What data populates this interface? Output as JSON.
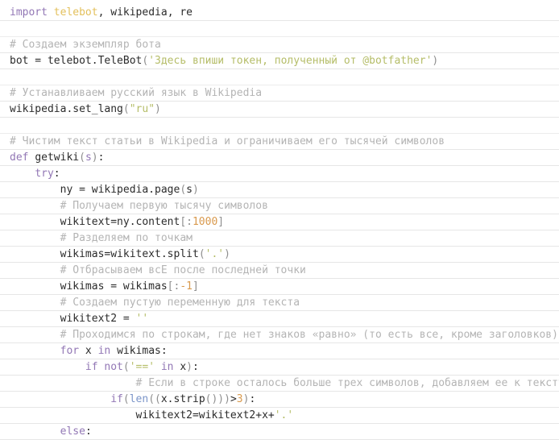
{
  "document": {
    "kind": "python-source-listing",
    "language": "Python",
    "theme": {
      "background": "#ffffff",
      "rule": "#e6e6e6",
      "plain": "#2b2b2b",
      "keyword": "#9277b5",
      "module": "#e3c05c",
      "string": "#b5bd68",
      "number": "#d99a4e",
      "comment": "#b4b4b4",
      "punctuation": "#8f8f8f",
      "builtin": "#7b95c9"
    }
  },
  "lines": [
    {
      "id": 1,
      "blank": false,
      "text": "import telebot, wikipedia, re",
      "tokens": [
        {
          "t": "import",
          "c": "kw"
        },
        {
          "t": " ",
          "c": "plain"
        },
        {
          "t": "telebot",
          "c": "mod"
        },
        {
          "t": ", ",
          "c": "plain"
        },
        {
          "t": "wikipedia",
          "c": "plain"
        },
        {
          "t": ", ",
          "c": "plain"
        },
        {
          "t": "re",
          "c": "plain"
        }
      ]
    },
    {
      "id": 2,
      "blank": true,
      "text": "",
      "tokens": []
    },
    {
      "id": 3,
      "blank": false,
      "text": "# Создаем экземпляр бота",
      "tokens": [
        {
          "t": "# Создаем экземпляр бота",
          "c": "com"
        }
      ]
    },
    {
      "id": 4,
      "blank": false,
      "text": "bot = telebot.TeleBot('Здесь впиши токен, полученный от @botfather')",
      "tokens": [
        {
          "t": "bot = telebot.TeleBot",
          "c": "plain"
        },
        {
          "t": "(",
          "c": "punct"
        },
        {
          "t": "'Здесь впиши токен, полученный от @botfather'",
          "c": "str"
        },
        {
          "t": ")",
          "c": "punct"
        }
      ]
    },
    {
      "id": 5,
      "blank": true,
      "text": "",
      "tokens": []
    },
    {
      "id": 6,
      "blank": false,
      "text": "# Устанавливаем русский язык в Wikipedia",
      "tokens": [
        {
          "t": "# Устанавливаем русский язык в Wikipedia",
          "c": "com"
        }
      ]
    },
    {
      "id": 7,
      "blank": false,
      "text": "wikipedia.set_lang(\"ru\")",
      "tokens": [
        {
          "t": "wikipedia.set_lang",
          "c": "plain"
        },
        {
          "t": "(",
          "c": "punct"
        },
        {
          "t": "\"ru\"",
          "c": "str"
        },
        {
          "t": ")",
          "c": "punct"
        }
      ]
    },
    {
      "id": 8,
      "blank": true,
      "text": "",
      "tokens": []
    },
    {
      "id": 9,
      "blank": false,
      "text": "# Чистим текст статьи в Wikipedia и ограничиваем его тысячей символов",
      "tokens": [
        {
          "t": "# Чистим текст статьи в Wikipedia и ограничиваем его тысячей символов",
          "c": "com"
        }
      ]
    },
    {
      "id": 10,
      "blank": false,
      "text": "def getwiki(s):",
      "tokens": [
        {
          "t": "def",
          "c": "kw"
        },
        {
          "t": " ",
          "c": "plain"
        },
        {
          "t": "getwiki",
          "c": "fn"
        },
        {
          "t": "(",
          "c": "punct"
        },
        {
          "t": "s",
          "c": "param"
        },
        {
          "t": ")",
          "c": "punct"
        },
        {
          "t": ":",
          "c": "plain"
        }
      ]
    },
    {
      "id": 11,
      "blank": false,
      "text": "    try:",
      "tokens": [
        {
          "t": "    ",
          "c": "plain"
        },
        {
          "t": "try",
          "c": "kw"
        },
        {
          "t": ":",
          "c": "plain"
        }
      ]
    },
    {
      "id": 12,
      "blank": false,
      "text": "        ny = wikipedia.page(s)",
      "tokens": [
        {
          "t": "        ny = wikipedia.page",
          "c": "plain"
        },
        {
          "t": "(",
          "c": "punct"
        },
        {
          "t": "s",
          "c": "plain"
        },
        {
          "t": ")",
          "c": "punct"
        }
      ]
    },
    {
      "id": 13,
      "blank": false,
      "text": "        # Получаем первую тысячу символов",
      "tokens": [
        {
          "t": "        ",
          "c": "plain"
        },
        {
          "t": "# Получаем первую тысячу символов",
          "c": "com"
        }
      ]
    },
    {
      "id": 14,
      "blank": false,
      "text": "        wikitext=ny.content[:1000]",
      "tokens": [
        {
          "t": "        wikitext=ny.content",
          "c": "plain"
        },
        {
          "t": "[:",
          "c": "punct"
        },
        {
          "t": "1000",
          "c": "num"
        },
        {
          "t": "]",
          "c": "punct"
        }
      ]
    },
    {
      "id": 15,
      "blank": false,
      "text": "        # Разделяем по точкам",
      "tokens": [
        {
          "t": "        ",
          "c": "plain"
        },
        {
          "t": "# Разделяем по точкам",
          "c": "com"
        }
      ]
    },
    {
      "id": 16,
      "blank": false,
      "text": "        wikimas=wikitext.split('.')",
      "tokens": [
        {
          "t": "        wikimas=wikitext.split",
          "c": "plain"
        },
        {
          "t": "(",
          "c": "punct"
        },
        {
          "t": "'.'",
          "c": "str"
        },
        {
          "t": ")",
          "c": "punct"
        }
      ]
    },
    {
      "id": 17,
      "blank": false,
      "text": "        # Отбрасываем всЕ после последней точки",
      "tokens": [
        {
          "t": "        ",
          "c": "plain"
        },
        {
          "t": "# Отбрасываем всЕ после последней точки",
          "c": "com"
        }
      ]
    },
    {
      "id": 18,
      "blank": false,
      "text": "        wikimas = wikimas[:-1]",
      "tokens": [
        {
          "t": "        wikimas = wikimas",
          "c": "plain"
        },
        {
          "t": "[:",
          "c": "punct"
        },
        {
          "t": "-1",
          "c": "num"
        },
        {
          "t": "]",
          "c": "punct"
        }
      ]
    },
    {
      "id": 19,
      "blank": false,
      "text": "        # Создаем пустую переменную для текста",
      "tokens": [
        {
          "t": "        ",
          "c": "plain"
        },
        {
          "t": "# Создаем пустую переменную для текста",
          "c": "com"
        }
      ]
    },
    {
      "id": 20,
      "blank": false,
      "text": "        wikitext2 = ''",
      "tokens": [
        {
          "t": "        wikitext2 = ",
          "c": "plain"
        },
        {
          "t": "''",
          "c": "str"
        }
      ]
    },
    {
      "id": 21,
      "blank": false,
      "text": "        # Проходимся по строкам, где нет знаков «равно» (то есть все, кроме заголовков)",
      "tokens": [
        {
          "t": "        ",
          "c": "plain"
        },
        {
          "t": "# Проходимся по строкам, где нет знаков «равно» (то есть все, кроме заголовков)",
          "c": "com"
        }
      ]
    },
    {
      "id": 22,
      "blank": false,
      "text": "        for x in wikimas:",
      "tokens": [
        {
          "t": "        ",
          "c": "plain"
        },
        {
          "t": "for",
          "c": "kw"
        },
        {
          "t": " x ",
          "c": "plain"
        },
        {
          "t": "in",
          "c": "kw"
        },
        {
          "t": " wikimas:",
          "c": "plain"
        }
      ]
    },
    {
      "id": 23,
      "blank": false,
      "text": "            if not('==' in x):",
      "tokens": [
        {
          "t": "            ",
          "c": "plain"
        },
        {
          "t": "if",
          "c": "kw"
        },
        {
          "t": " ",
          "c": "plain"
        },
        {
          "t": "not",
          "c": "kw"
        },
        {
          "t": "(",
          "c": "punct"
        },
        {
          "t": "'=='",
          "c": "str"
        },
        {
          "t": " ",
          "c": "plain"
        },
        {
          "t": "in",
          "c": "kw"
        },
        {
          "t": " x",
          "c": "plain"
        },
        {
          "t": ")",
          "c": "punct"
        },
        {
          "t": ":",
          "c": "plain"
        }
      ]
    },
    {
      "id": 24,
      "blank": false,
      "text": "                    # Если в строке осталось больше трех символов, добавляем ее к тексту",
      "tokens": [
        {
          "t": "                    ",
          "c": "plain"
        },
        {
          "t": "# Если в строке осталось больше трех символов, добавляем ее к тексту",
          "c": "com"
        }
      ]
    },
    {
      "id": 25,
      "blank": false,
      "text": "                if(len((x.strip()))>3):",
      "tokens": [
        {
          "t": "                ",
          "c": "plain"
        },
        {
          "t": "if",
          "c": "kw"
        },
        {
          "t": "(",
          "c": "punct"
        },
        {
          "t": "len",
          "c": "builtin"
        },
        {
          "t": "((",
          "c": "punct"
        },
        {
          "t": "x.strip",
          "c": "plain"
        },
        {
          "t": "()))",
          "c": "punct"
        },
        {
          "t": ">",
          "c": "plain"
        },
        {
          "t": "3",
          "c": "num"
        },
        {
          "t": ")",
          "c": "punct"
        },
        {
          "t": ":",
          "c": "plain"
        }
      ]
    },
    {
      "id": 26,
      "blank": false,
      "text": "                    wikitext2=wikitext2+x+'.'",
      "tokens": [
        {
          "t": "                    wikitext2=wikitext2+x+",
          "c": "plain"
        },
        {
          "t": "'.'",
          "c": "str"
        }
      ]
    },
    {
      "id": 27,
      "blank": false,
      "text": "        else:",
      "tokens": [
        {
          "t": "        ",
          "c": "plain"
        },
        {
          "t": "else",
          "c": "kw"
        },
        {
          "t": ":",
          "c": "plain"
        }
      ]
    }
  ]
}
